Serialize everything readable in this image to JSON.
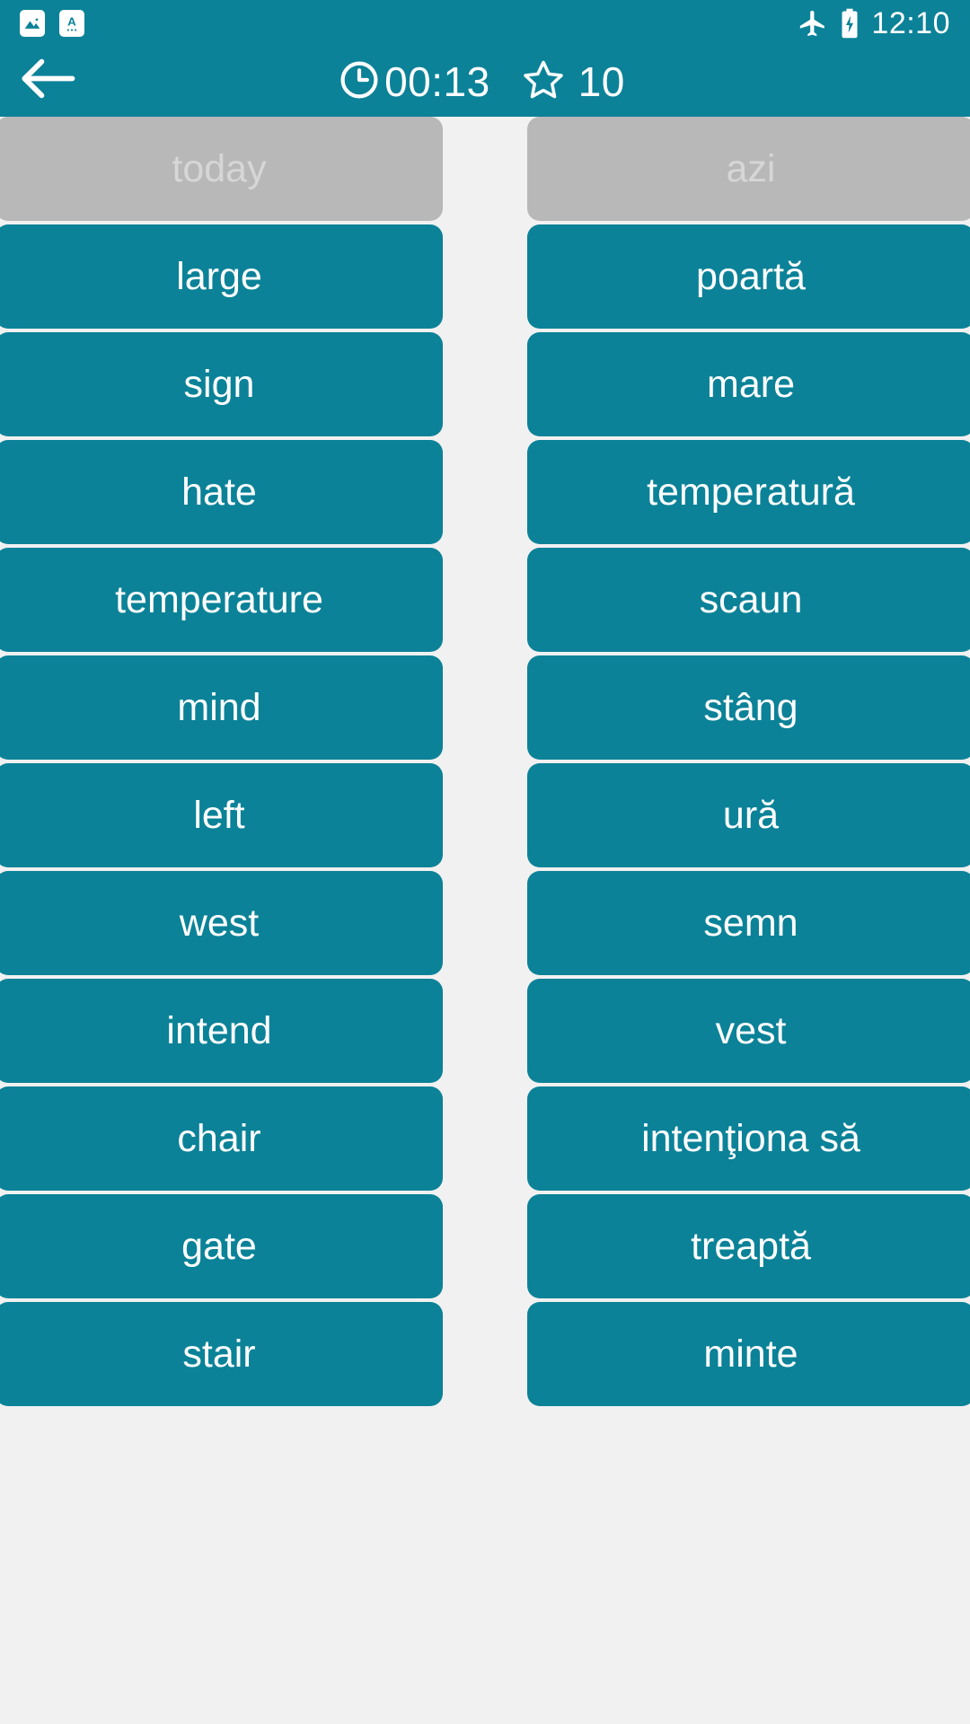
{
  "status_bar": {
    "notifications": [
      {
        "icon": "image-notification-icon"
      },
      {
        "icon": "translate-notification-icon"
      }
    ],
    "system_icons": [
      {
        "icon": "airplane-mode-icon"
      },
      {
        "icon": "battery-charging-icon"
      }
    ],
    "time": "12:10"
  },
  "app_bar": {
    "back_icon": "back-arrow-icon",
    "timer_icon": "clock-icon",
    "timer_value": "00:13",
    "star_icon": "star-icon",
    "star_count": "10"
  },
  "colors": {
    "accent_teal": "#0b8298",
    "matched_gray": "#b8b8b8",
    "matched_text": "#d6d6d6",
    "background": "#f1f1f1",
    "tile_text": "#ffffff"
  },
  "board": {
    "left_column": [
      {
        "label": "today",
        "state": "matched"
      },
      {
        "label": "large",
        "state": "active"
      },
      {
        "label": "sign",
        "state": "active"
      },
      {
        "label": "hate",
        "state": "active"
      },
      {
        "label": "temperature",
        "state": "active"
      },
      {
        "label": "mind",
        "state": "active"
      },
      {
        "label": "left",
        "state": "active"
      },
      {
        "label": "west",
        "state": "active"
      },
      {
        "label": "intend",
        "state": "active"
      },
      {
        "label": "chair",
        "state": "active"
      },
      {
        "label": "gate",
        "state": "active"
      },
      {
        "label": "stair",
        "state": "active"
      }
    ],
    "right_column": [
      {
        "label": "azi",
        "state": "matched"
      },
      {
        "label": "poartă",
        "state": "active"
      },
      {
        "label": "mare",
        "state": "active"
      },
      {
        "label": "temperatură",
        "state": "active"
      },
      {
        "label": "scaun",
        "state": "active"
      },
      {
        "label": "stâng",
        "state": "active"
      },
      {
        "label": "ură",
        "state": "active"
      },
      {
        "label": "semn",
        "state": "active"
      },
      {
        "label": "vest",
        "state": "active"
      },
      {
        "label": "intenţiona să",
        "state": "active"
      },
      {
        "label": "treaptă",
        "state": "active"
      },
      {
        "label": "minte",
        "state": "active"
      }
    ]
  }
}
